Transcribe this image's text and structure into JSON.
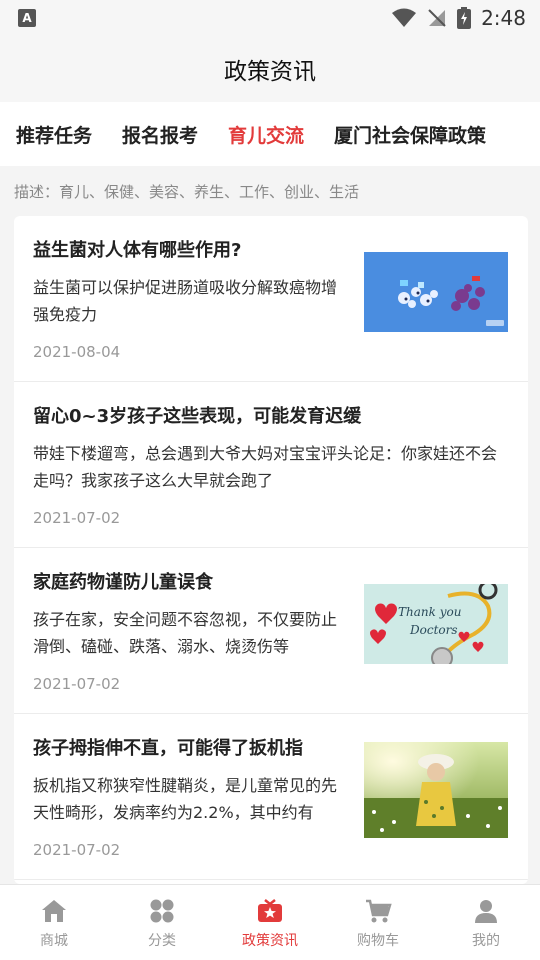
{
  "status_bar": {
    "time": "2:48",
    "app_icon_letter": "A"
  },
  "header": {
    "title": "政策资讯"
  },
  "tabs": [
    {
      "label": "推荐任务",
      "active": false
    },
    {
      "label": "报名报考",
      "active": false
    },
    {
      "label": "育儿交流",
      "active": true
    },
    {
      "label": "厦门社会保障政策",
      "active": false
    }
  ],
  "description": "描述：育儿、保健、美容、养生、工作、创业、生活",
  "articles": [
    {
      "title": "益生菌对人体有哪些作用?",
      "summary": "益生菌可以保护促进肠道吸收分解致癌物增强免疫力",
      "date": "2021-08-04",
      "thumbnail": "probiotics-illustration"
    },
    {
      "title": "留心0~3岁孩子这些表现，可能发育迟缓",
      "summary": "带娃下楼遛弯，总会遇到大爷大妈对宝宝评头论足：你家娃还不会走吗？我家孩子这么大早就会跑了",
      "date": "2021-07-02",
      "thumbnail": null
    },
    {
      "title": "家庭药物谨防儿童误食",
      "summary": "孩子在家，安全问题不容忽视，不仅要防止滑倒、磕碰、跌落、溺水、烧烫伤等",
      "date": "2021-07-02",
      "thumbnail": "thank-you-doctors-stethoscope",
      "thumb_text": [
        "Thank you",
        "Doctors"
      ]
    },
    {
      "title": "孩子拇指伸不直，可能得了扳机指",
      "summary": "扳机指又称狭窄性腱鞘炎，是儿童常见的先天性畸形，发病率约为2.2%，其中约有",
      "date": "2021-07-02",
      "thumbnail": "child-in-field-photo"
    }
  ],
  "bottom_nav": [
    {
      "label": "商城",
      "icon": "home-icon",
      "active": false
    },
    {
      "label": "分类",
      "icon": "category-icon",
      "active": false
    },
    {
      "label": "政策资讯",
      "icon": "news-icon",
      "active": true
    },
    {
      "label": "购物车",
      "icon": "cart-icon",
      "active": false
    },
    {
      "label": "我的",
      "icon": "profile-icon",
      "active": false
    }
  ],
  "colors": {
    "accent": "#e23b3b",
    "muted": "#999999",
    "background": "#f4f4f4"
  }
}
